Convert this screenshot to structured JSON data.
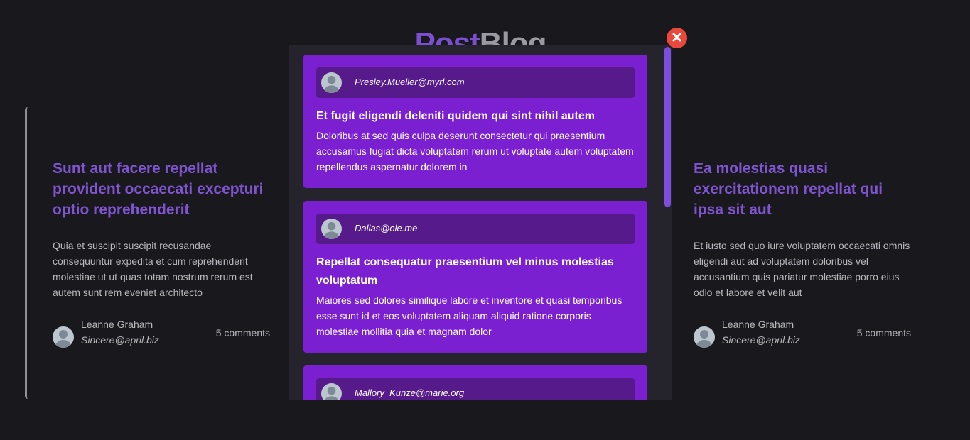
{
  "logo": {
    "part1": "Post",
    "part2": "Blog"
  },
  "cards": [
    {
      "title": "Sunt aut facere repellat provident occaecati excepturi optio reprehenderit",
      "body": "Quia et suscipit suscipit recusandae consequuntur expedita et cum reprehenderit molestiae ut ut quas totam nostrum rerum est autem sunt rem eveniet architecto",
      "author": "Leanne Graham",
      "email": "Sincere@april.biz",
      "comments": "5 comments"
    },
    {
      "title": "Ea molestias quasi exercitationem repellat qui ipsa sit aut",
      "body": "Et iusto sed quo iure voluptatem occaecati omnis eligendi aut ad voluptatem doloribus vel accusantium quis pariatur molestiae porro eius odio et labore et velit aut",
      "author": "Leanne Graham",
      "email": "Sincere@april.biz",
      "comments": "5 comments"
    }
  ],
  "modal": {
    "comments": [
      {
        "email": "Presley.Mueller@myrl.com",
        "title": "Et fugit eligendi deleniti quidem qui sint nihil autem",
        "body": "Doloribus at sed quis culpa deserunt consectetur qui praesentium accusamus fugiat dicta voluptatem rerum ut voluptate autem voluptatem repellendus aspernatur dolorem in"
      },
      {
        "email": "Dallas@ole.me",
        "title": "Repellat consequatur praesentium vel minus molestias voluptatum",
        "body": "Maiores sed dolores similique labore et inventore et quasi temporibus esse sunt id et eos voluptatem aliquam aliquid ratione corporis molestiae mollitia quia et magnam dolor"
      },
      {
        "email": "Mallory_Kunze@marie.org",
        "title": "",
        "body": ""
      }
    ]
  },
  "icons": {
    "close": "close-icon",
    "avatar": "user-avatar-icon"
  },
  "colors": {
    "background": "#19181d",
    "accent": "#7f55cf",
    "comment_card": "#7b20d1",
    "comment_header": "#561a8b",
    "close_button": "#e9493d"
  }
}
